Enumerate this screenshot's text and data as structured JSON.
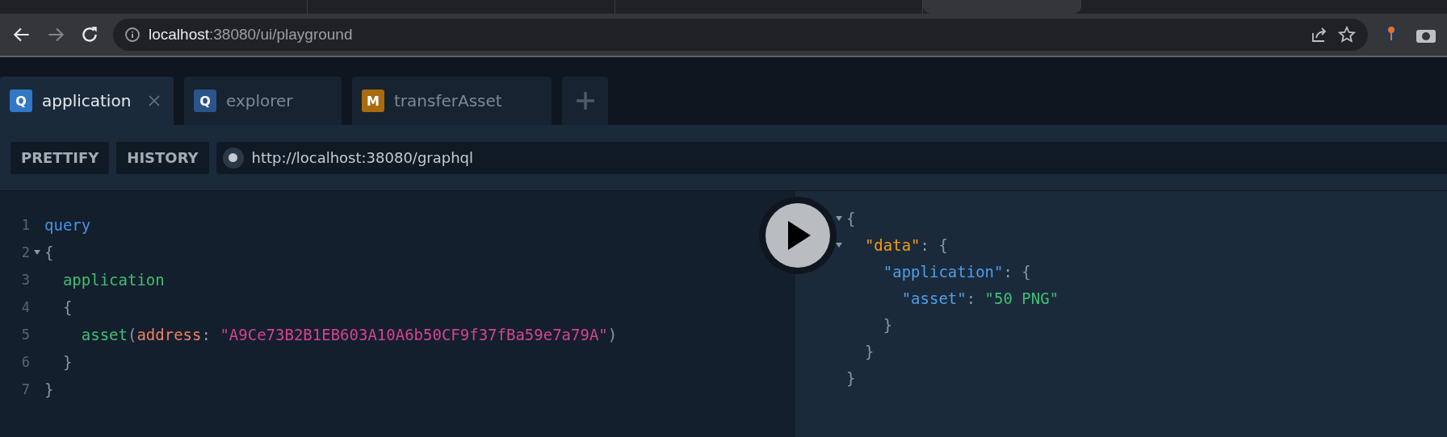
{
  "browser": {
    "tabs": [
      {
        "selected": false
      },
      {
        "selected": false
      },
      {
        "selected": false
      },
      {
        "selected": true
      }
    ],
    "url_host": "localhost",
    "url_path": ":38080/ui/playground"
  },
  "tabs": [
    {
      "badge": "Q",
      "kind": "query",
      "label": "application",
      "selected": true,
      "closable": true
    },
    {
      "badge": "Q",
      "kind": "query",
      "label": "explorer",
      "selected": false,
      "closable": false
    },
    {
      "badge": "M",
      "kind": "mutation",
      "label": "transferAsset",
      "selected": false,
      "closable": false
    }
  ],
  "toolbar": {
    "buttons": [
      "PRETTIFY",
      "HISTORY"
    ],
    "endpoint": "http://localhost:38080/graphql"
  },
  "editor": {
    "lines": [
      {
        "number": "1",
        "foldable": false,
        "tokens": [
          {
            "kind": "keyword",
            "text": "query"
          }
        ]
      },
      {
        "number": "2",
        "foldable": true,
        "tokens": [
          {
            "kind": "punct",
            "text": "{"
          }
        ]
      },
      {
        "number": "3",
        "foldable": false,
        "tokens": [
          {
            "kind": "field",
            "text": "  application"
          }
        ]
      },
      {
        "number": "4",
        "foldable": false,
        "tokens": [
          {
            "kind": "punct",
            "text": "  {"
          }
        ]
      },
      {
        "number": "5",
        "foldable": false,
        "tokens": [
          {
            "kind": "field",
            "text": "    asset"
          },
          {
            "kind": "punct",
            "text": "("
          },
          {
            "kind": "arg",
            "text": "address"
          },
          {
            "kind": "punct",
            "text": ": "
          },
          {
            "kind": "string",
            "text": "\"A9Ce73B2B1EB603A10A6b50CF9f37fBa59e7a79A\""
          },
          {
            "kind": "punct",
            "text": ")"
          }
        ]
      },
      {
        "number": "6",
        "foldable": false,
        "tokens": [
          {
            "kind": "punct",
            "text": "  }"
          }
        ]
      },
      {
        "number": "7",
        "foldable": false,
        "tokens": [
          {
            "kind": "punct",
            "text": "}"
          }
        ]
      }
    ]
  },
  "result": {
    "lines": [
      {
        "foldable": true,
        "tokens": [
          {
            "kind": "punct",
            "text": "{"
          }
        ]
      },
      {
        "foldable": true,
        "tokens": [
          {
            "kind": "key",
            "text": "  \"data\""
          },
          {
            "kind": "punct",
            "text": ": {"
          }
        ]
      },
      {
        "foldable": false,
        "tokens": [
          {
            "kind": "prop",
            "text": "    \"application\""
          },
          {
            "kind": "punct",
            "text": ": {"
          }
        ]
      },
      {
        "foldable": false,
        "tokens": [
          {
            "kind": "prop",
            "text": "      \"asset\""
          },
          {
            "kind": "punct",
            "text": ": "
          },
          {
            "kind": "value",
            "text": "\"50 PNG\""
          }
        ]
      },
      {
        "foldable": false,
        "tokens": [
          {
            "kind": "punct",
            "text": "    }"
          }
        ]
      },
      {
        "foldable": false,
        "tokens": [
          {
            "kind": "punct",
            "text": "  }"
          }
        ]
      },
      {
        "foldable": false,
        "tokens": [
          {
            "kind": "punct",
            "text": "}"
          }
        ]
      }
    ]
  }
}
